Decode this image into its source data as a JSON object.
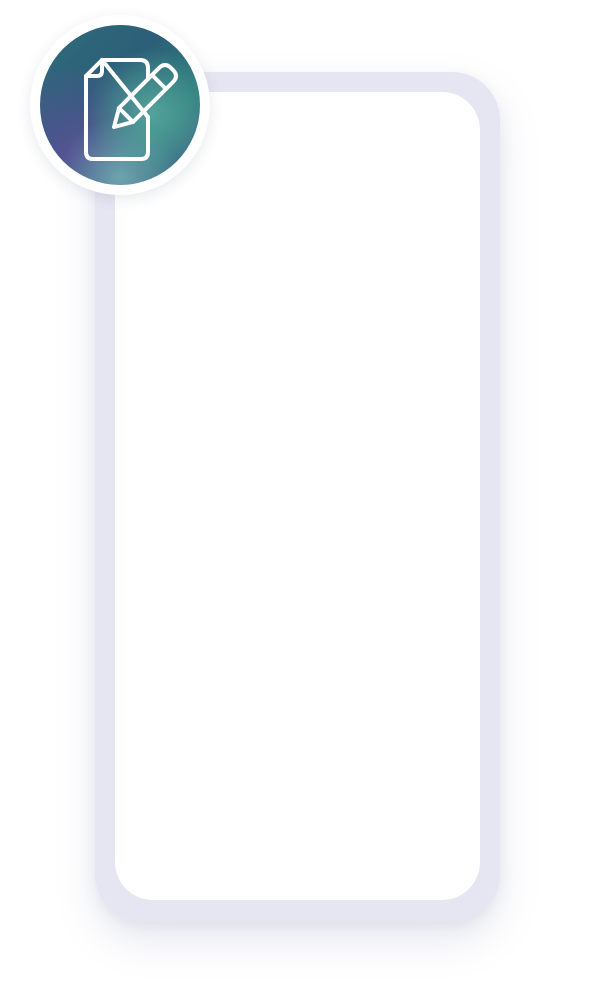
{
  "badge": {
    "icon": "document-edit-icon",
    "colors": {
      "gradient_start": "#2f6b7c",
      "gradient_mid": "#2f7f7d",
      "gradient_end": "#4a5d8f",
      "icon_stroke": "#ffffff"
    }
  },
  "device": {
    "frame_color": "#e5e6f1",
    "screen_color": "#ffffff"
  }
}
